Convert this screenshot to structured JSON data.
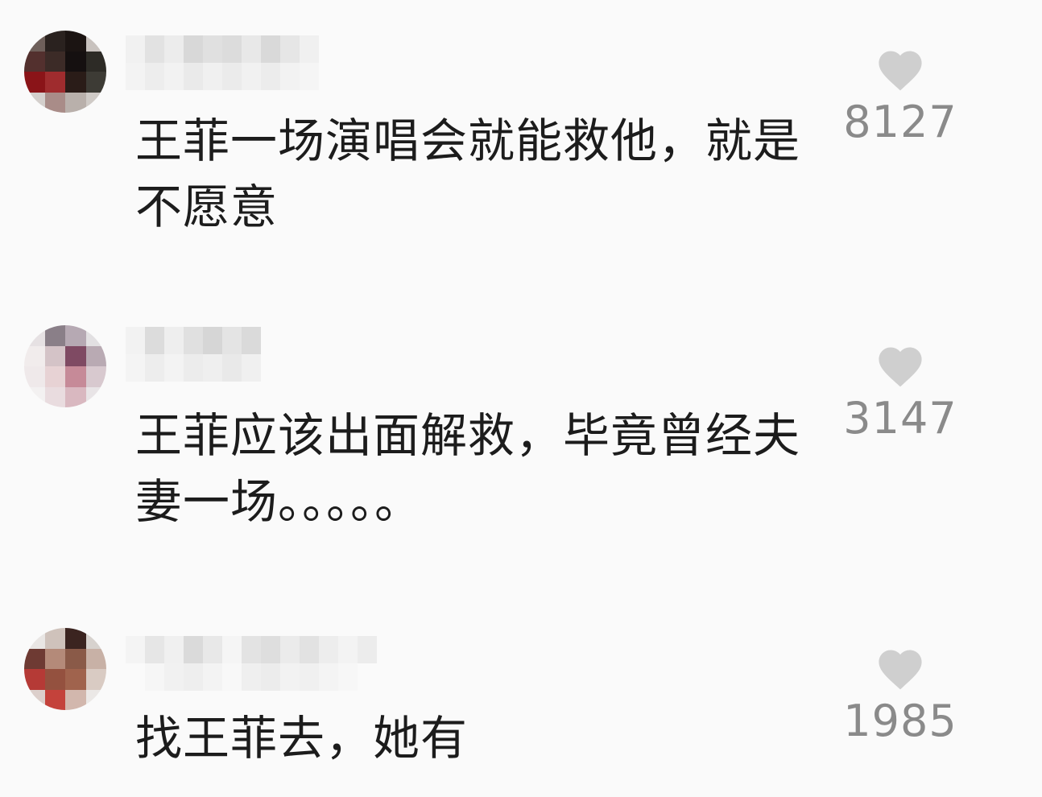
{
  "comments": [
    {
      "username": "",
      "text": "王菲一场演唱会就能救他，就是不愿意",
      "likes": "8127",
      "avatar_colors": [
        "#6e5f5a",
        "#2a221f",
        "#1b1412",
        "#c8c2be",
        "#53302e",
        "#3c2b27",
        "#151010",
        "#2d2b26",
        "#8a1418",
        "#9f2c2e",
        "#2a1c18",
        "#3d3b35",
        "#d4cfcc",
        "#a98c88",
        "#b9b0ab",
        "#cfcac6"
      ]
    },
    {
      "username": "",
      "text": "王菲应该出面解救，毕竟曾经夫妻一场。。。。。",
      "likes": "3147",
      "avatar_colors": [
        "#e6e1e3",
        "#8a7f88",
        "#b6a9b3",
        "#e2e0e2",
        "#f1ecec",
        "#d4c3c7",
        "#7f4a63",
        "#b9aab3",
        "#efe9ea",
        "#e7d2d4",
        "#c68a98",
        "#d8c9cf",
        "#f3f1f1",
        "#e9dcdf",
        "#d9b8c0",
        "#e8e4e6"
      ]
    },
    {
      "username": "",
      "text": "找王菲去，她有",
      "likes": "1985",
      "avatar_colors": [
        "#e9e6e4",
        "#cfc2bb",
        "#3b2420",
        "#d7d2ce",
        "#6e3a33",
        "#b48a79",
        "#8a5a48",
        "#c8b1a6",
        "#b53a36",
        "#94513f",
        "#a0634d",
        "#d9cbc3",
        "#dccfcb",
        "#c4423b",
        "#d2b7ad",
        "#ebe8e6"
      ]
    }
  ],
  "icons": {
    "like": "heart-icon"
  },
  "colors": {
    "background": "#fafafa",
    "text": "#1c1c1c",
    "like_count": "#8a8a8a",
    "heart": "#cfcfcf"
  }
}
